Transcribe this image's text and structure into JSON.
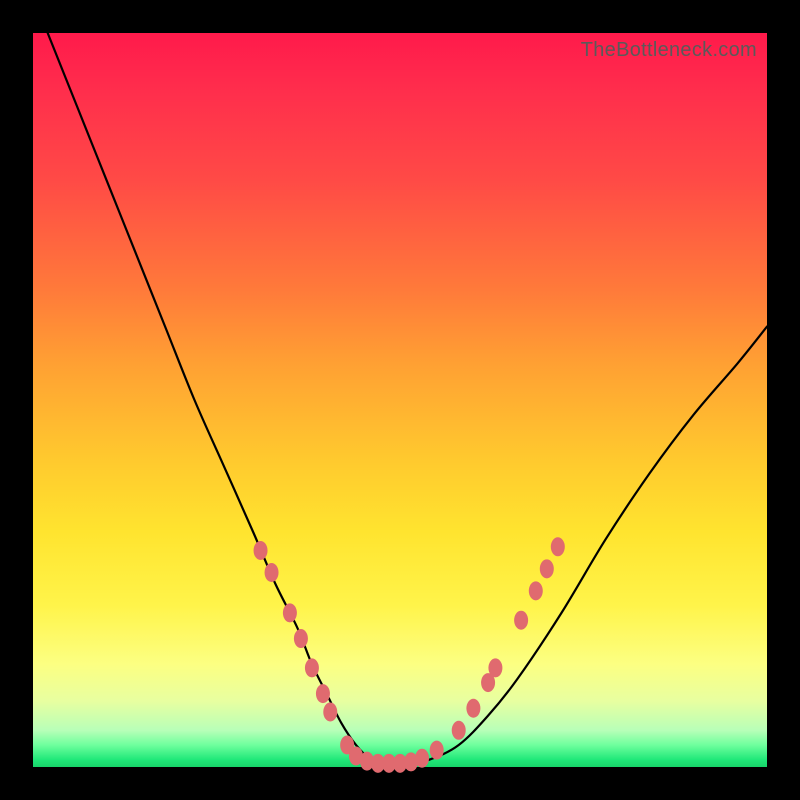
{
  "site": {
    "watermark": "TheBottleneck.com"
  },
  "chart_data": {
    "type": "line",
    "title": "",
    "xlabel": "",
    "ylabel": "",
    "xlim": [
      0,
      100
    ],
    "ylim": [
      0,
      100
    ],
    "grid": false,
    "legend": false,
    "annotations": [],
    "background": "rainbow-gradient-vertical",
    "series": [
      {
        "name": "bottleneck-curve",
        "color": "#000000",
        "x": [
          2,
          6,
          10,
          14,
          18,
          22,
          26,
          30,
          33,
          36,
          38,
          40,
          42,
          44,
          46,
          48,
          50,
          54,
          58,
          62,
          66,
          72,
          78,
          84,
          90,
          96,
          100
        ],
        "y": [
          100,
          90,
          80,
          70,
          60,
          50,
          41,
          32,
          25,
          19,
          14,
          10,
          6,
          3,
          1,
          0,
          0,
          1,
          3,
          7,
          12,
          21,
          31,
          40,
          48,
          55,
          60
        ]
      }
    ],
    "markers": {
      "name": "highlight-dots",
      "shape": "ellipse",
      "color": "#e06a6f",
      "points": [
        {
          "x": 31.0,
          "y": 29.5
        },
        {
          "x": 32.5,
          "y": 26.5
        },
        {
          "x": 35.0,
          "y": 21.0
        },
        {
          "x": 36.5,
          "y": 17.5
        },
        {
          "x": 38.0,
          "y": 13.5
        },
        {
          "x": 39.5,
          "y": 10.0
        },
        {
          "x": 40.5,
          "y": 7.5
        },
        {
          "x": 42.8,
          "y": 3.0
        },
        {
          "x": 44.0,
          "y": 1.5
        },
        {
          "x": 45.5,
          "y": 0.8
        },
        {
          "x": 47.0,
          "y": 0.5
        },
        {
          "x": 48.5,
          "y": 0.5
        },
        {
          "x": 50.0,
          "y": 0.5
        },
        {
          "x": 51.5,
          "y": 0.7
        },
        {
          "x": 53.0,
          "y": 1.2
        },
        {
          "x": 55.0,
          "y": 2.3
        },
        {
          "x": 58.0,
          "y": 5.0
        },
        {
          "x": 60.0,
          "y": 8.0
        },
        {
          "x": 62.0,
          "y": 11.5
        },
        {
          "x": 63.0,
          "y": 13.5
        },
        {
          "x": 66.5,
          "y": 20.0
        },
        {
          "x": 68.5,
          "y": 24.0
        },
        {
          "x": 70.0,
          "y": 27.0
        },
        {
          "x": 71.5,
          "y": 30.0
        }
      ]
    }
  }
}
